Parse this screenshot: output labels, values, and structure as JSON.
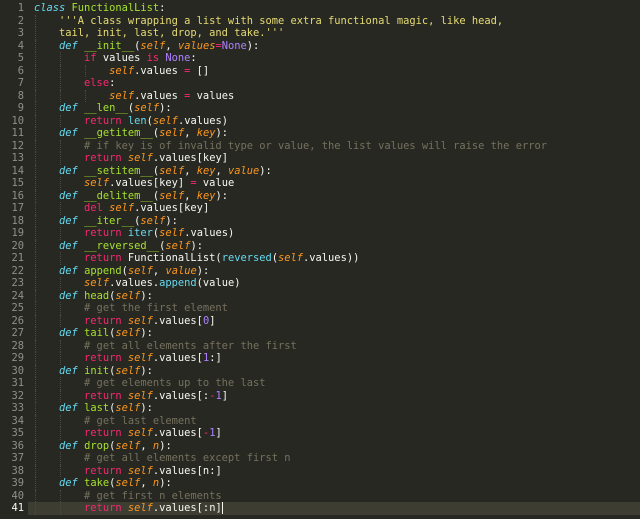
{
  "editor": {
    "theme_colors": {
      "background": "#272822",
      "keyword": "#f92672",
      "function": "#a6e22e",
      "parameter": "#fd971f",
      "builtin": "#66d9ef",
      "constant": "#ae81ff",
      "comment": "#75715e",
      "string": "#e6db74",
      "text": "#f8f8f2"
    },
    "active_line": 41,
    "lines": [
      {
        "n": 1,
        "indent": 0,
        "tokens": [
          [
            "st",
            "class"
          ],
          [
            "pl",
            " "
          ],
          [
            "fn",
            "FunctionalList"
          ],
          [
            "pl",
            ":"
          ]
        ]
      },
      {
        "n": 2,
        "indent": 4,
        "tokens": [
          [
            "sr",
            "'''A class wrapping a list with some extra functional magic, like head,"
          ]
        ]
      },
      {
        "n": 3,
        "indent": 4,
        "tokens": [
          [
            "sr",
            "tail, init, last, drop, and take.'''"
          ]
        ]
      },
      {
        "n": 4,
        "indent": 4,
        "tokens": [
          [
            "st",
            "def"
          ],
          [
            "pl",
            " "
          ],
          [
            "fn",
            "__init__"
          ],
          [
            "pl",
            "("
          ],
          [
            "sl",
            "self"
          ],
          [
            "pl",
            ", "
          ],
          [
            "pa",
            "values"
          ],
          [
            "op",
            "="
          ],
          [
            "co",
            "None"
          ],
          [
            "pl",
            "):"
          ]
        ]
      },
      {
        "n": 5,
        "indent": 8,
        "tokens": [
          [
            "kw",
            "if"
          ],
          [
            "pl",
            " values "
          ],
          [
            "kw",
            "is"
          ],
          [
            "pl",
            " "
          ],
          [
            "co",
            "None"
          ],
          [
            "pl",
            ":"
          ]
        ]
      },
      {
        "n": 6,
        "indent": 12,
        "tokens": [
          [
            "sl",
            "self"
          ],
          [
            "pl",
            ".values "
          ],
          [
            "op",
            "="
          ],
          [
            "pl",
            " []"
          ]
        ]
      },
      {
        "n": 7,
        "indent": 8,
        "tokens": [
          [
            "kw",
            "else"
          ],
          [
            "pl",
            ":"
          ]
        ]
      },
      {
        "n": 8,
        "indent": 12,
        "tokens": [
          [
            "sl",
            "self"
          ],
          [
            "pl",
            ".values "
          ],
          [
            "op",
            "="
          ],
          [
            "pl",
            " values"
          ]
        ]
      },
      {
        "n": 9,
        "indent": 4,
        "tokens": [
          [
            "st",
            "def"
          ],
          [
            "pl",
            " "
          ],
          [
            "fn",
            "__len__"
          ],
          [
            "pl",
            "("
          ],
          [
            "sl",
            "self"
          ],
          [
            "pl",
            "):"
          ]
        ]
      },
      {
        "n": 10,
        "indent": 8,
        "tokens": [
          [
            "kw",
            "return"
          ],
          [
            "pl",
            " "
          ],
          [
            "bi",
            "len"
          ],
          [
            "pl",
            "("
          ],
          [
            "sl",
            "self"
          ],
          [
            "pl",
            ".values)"
          ]
        ]
      },
      {
        "n": 11,
        "indent": 4,
        "tokens": [
          [
            "st",
            "def"
          ],
          [
            "pl",
            " "
          ],
          [
            "fn",
            "__getitem__"
          ],
          [
            "pl",
            "("
          ],
          [
            "sl",
            "self"
          ],
          [
            "pl",
            ", "
          ],
          [
            "pa",
            "key"
          ],
          [
            "pl",
            "):"
          ]
        ]
      },
      {
        "n": 12,
        "indent": 8,
        "tokens": [
          [
            "cm",
            "# if key is of invalid type or value, the list values will raise the error"
          ]
        ]
      },
      {
        "n": 13,
        "indent": 8,
        "tokens": [
          [
            "kw",
            "return"
          ],
          [
            "pl",
            " "
          ],
          [
            "sl",
            "self"
          ],
          [
            "pl",
            ".values[key]"
          ]
        ]
      },
      {
        "n": 14,
        "indent": 4,
        "tokens": [
          [
            "st",
            "def"
          ],
          [
            "pl",
            " "
          ],
          [
            "fn",
            "__setitem__"
          ],
          [
            "pl",
            "("
          ],
          [
            "sl",
            "self"
          ],
          [
            "pl",
            ", "
          ],
          [
            "pa",
            "key"
          ],
          [
            "pl",
            ", "
          ],
          [
            "pa",
            "value"
          ],
          [
            "pl",
            "):"
          ]
        ]
      },
      {
        "n": 15,
        "indent": 8,
        "tokens": [
          [
            "sl",
            "self"
          ],
          [
            "pl",
            ".values[key] "
          ],
          [
            "op",
            "="
          ],
          [
            "pl",
            " value"
          ]
        ]
      },
      {
        "n": 16,
        "indent": 4,
        "tokens": [
          [
            "st",
            "def"
          ],
          [
            "pl",
            " "
          ],
          [
            "fn",
            "__delitem__"
          ],
          [
            "pl",
            "("
          ],
          [
            "sl",
            "self"
          ],
          [
            "pl",
            ", "
          ],
          [
            "pa",
            "key"
          ],
          [
            "pl",
            "):"
          ]
        ]
      },
      {
        "n": 17,
        "indent": 8,
        "tokens": [
          [
            "kw",
            "del"
          ],
          [
            "pl",
            " "
          ],
          [
            "sl",
            "self"
          ],
          [
            "pl",
            ".values[key]"
          ]
        ]
      },
      {
        "n": 18,
        "indent": 4,
        "tokens": [
          [
            "st",
            "def"
          ],
          [
            "pl",
            " "
          ],
          [
            "fn",
            "__iter__"
          ],
          [
            "pl",
            "("
          ],
          [
            "sl",
            "self"
          ],
          [
            "pl",
            "):"
          ]
        ]
      },
      {
        "n": 19,
        "indent": 8,
        "tokens": [
          [
            "kw",
            "return"
          ],
          [
            "pl",
            " "
          ],
          [
            "bi",
            "iter"
          ],
          [
            "pl",
            "("
          ],
          [
            "sl",
            "self"
          ],
          [
            "pl",
            ".values)"
          ]
        ]
      },
      {
        "n": 20,
        "indent": 4,
        "tokens": [
          [
            "st",
            "def"
          ],
          [
            "pl",
            " "
          ],
          [
            "fn",
            "__reversed__"
          ],
          [
            "pl",
            "("
          ],
          [
            "sl",
            "self"
          ],
          [
            "pl",
            "):"
          ]
        ]
      },
      {
        "n": 21,
        "indent": 8,
        "tokens": [
          [
            "kw",
            "return"
          ],
          [
            "pl",
            " FunctionalList("
          ],
          [
            "bi",
            "reversed"
          ],
          [
            "pl",
            "("
          ],
          [
            "sl",
            "self"
          ],
          [
            "pl",
            ".values))"
          ]
        ]
      },
      {
        "n": 22,
        "indent": 4,
        "tokens": [
          [
            "st",
            "def"
          ],
          [
            "pl",
            " "
          ],
          [
            "fn",
            "append"
          ],
          [
            "pl",
            "("
          ],
          [
            "sl",
            "self"
          ],
          [
            "pl",
            ", "
          ],
          [
            "pa",
            "value"
          ],
          [
            "pl",
            "):"
          ]
        ]
      },
      {
        "n": 23,
        "indent": 8,
        "tokens": [
          [
            "sl",
            "self"
          ],
          [
            "pl",
            ".values."
          ],
          [
            "bi",
            "append"
          ],
          [
            "pl",
            "(value)"
          ]
        ]
      },
      {
        "n": 24,
        "indent": 4,
        "tokens": [
          [
            "st",
            "def"
          ],
          [
            "pl",
            " "
          ],
          [
            "fn",
            "head"
          ],
          [
            "pl",
            "("
          ],
          [
            "sl",
            "self"
          ],
          [
            "pl",
            "):"
          ]
        ]
      },
      {
        "n": 25,
        "indent": 8,
        "tokens": [
          [
            "cm",
            "# get the first element"
          ]
        ]
      },
      {
        "n": 26,
        "indent": 8,
        "tokens": [
          [
            "kw",
            "return"
          ],
          [
            "pl",
            " "
          ],
          [
            "sl",
            "self"
          ],
          [
            "pl",
            ".values["
          ],
          [
            "nu",
            "0"
          ],
          [
            "pl",
            "]"
          ]
        ]
      },
      {
        "n": 27,
        "indent": 4,
        "tokens": [
          [
            "st",
            "def"
          ],
          [
            "pl",
            " "
          ],
          [
            "fn",
            "tail"
          ],
          [
            "pl",
            "("
          ],
          [
            "sl",
            "self"
          ],
          [
            "pl",
            "):"
          ]
        ]
      },
      {
        "n": 28,
        "indent": 8,
        "tokens": [
          [
            "cm",
            "# get all elements after the first"
          ]
        ]
      },
      {
        "n": 29,
        "indent": 8,
        "tokens": [
          [
            "kw",
            "return"
          ],
          [
            "pl",
            " "
          ],
          [
            "sl",
            "self"
          ],
          [
            "pl",
            ".values["
          ],
          [
            "nu",
            "1"
          ],
          [
            "pl",
            ":]"
          ]
        ]
      },
      {
        "n": 30,
        "indent": 4,
        "tokens": [
          [
            "st",
            "def"
          ],
          [
            "pl",
            " "
          ],
          [
            "fn",
            "init"
          ],
          [
            "pl",
            "("
          ],
          [
            "sl",
            "self"
          ],
          [
            "pl",
            "):"
          ]
        ]
      },
      {
        "n": 31,
        "indent": 8,
        "tokens": [
          [
            "cm",
            "# get elements up to the last"
          ]
        ]
      },
      {
        "n": 32,
        "indent": 8,
        "tokens": [
          [
            "kw",
            "return"
          ],
          [
            "pl",
            " "
          ],
          [
            "sl",
            "self"
          ],
          [
            "pl",
            ".values[:"
          ],
          [
            "op",
            "-"
          ],
          [
            "nu",
            "1"
          ],
          [
            "pl",
            "]"
          ]
        ]
      },
      {
        "n": 33,
        "indent": 4,
        "tokens": [
          [
            "st",
            "def"
          ],
          [
            "pl",
            " "
          ],
          [
            "fn",
            "last"
          ],
          [
            "pl",
            "("
          ],
          [
            "sl",
            "self"
          ],
          [
            "pl",
            "):"
          ]
        ]
      },
      {
        "n": 34,
        "indent": 8,
        "tokens": [
          [
            "cm",
            "# get last element"
          ]
        ]
      },
      {
        "n": 35,
        "indent": 8,
        "tokens": [
          [
            "kw",
            "return"
          ],
          [
            "pl",
            " "
          ],
          [
            "sl",
            "self"
          ],
          [
            "pl",
            ".values["
          ],
          [
            "op",
            "-"
          ],
          [
            "nu",
            "1"
          ],
          [
            "pl",
            "]"
          ]
        ]
      },
      {
        "n": 36,
        "indent": 4,
        "tokens": [
          [
            "st",
            "def"
          ],
          [
            "pl",
            " "
          ],
          [
            "fn",
            "drop"
          ],
          [
            "pl",
            "("
          ],
          [
            "sl",
            "self"
          ],
          [
            "pl",
            ", "
          ],
          [
            "pa",
            "n"
          ],
          [
            "pl",
            "):"
          ]
        ]
      },
      {
        "n": 37,
        "indent": 8,
        "tokens": [
          [
            "cm",
            "# get all elements except first n"
          ]
        ]
      },
      {
        "n": 38,
        "indent": 8,
        "tokens": [
          [
            "kw",
            "return"
          ],
          [
            "pl",
            " "
          ],
          [
            "sl",
            "self"
          ],
          [
            "pl",
            ".values[n:]"
          ]
        ]
      },
      {
        "n": 39,
        "indent": 4,
        "tokens": [
          [
            "st",
            "def"
          ],
          [
            "pl",
            " "
          ],
          [
            "fn",
            "take"
          ],
          [
            "pl",
            "("
          ],
          [
            "sl",
            "self"
          ],
          [
            "pl",
            ", "
          ],
          [
            "pa",
            "n"
          ],
          [
            "pl",
            "):"
          ]
        ]
      },
      {
        "n": 40,
        "indent": 8,
        "tokens": [
          [
            "cm",
            "# get first n elements"
          ]
        ]
      },
      {
        "n": 41,
        "indent": 8,
        "tokens": [
          [
            "kw",
            "return"
          ],
          [
            "pl",
            " "
          ],
          [
            "sl",
            "self"
          ],
          [
            "pl",
            ".values[:n]"
          ]
        ]
      }
    ]
  }
}
